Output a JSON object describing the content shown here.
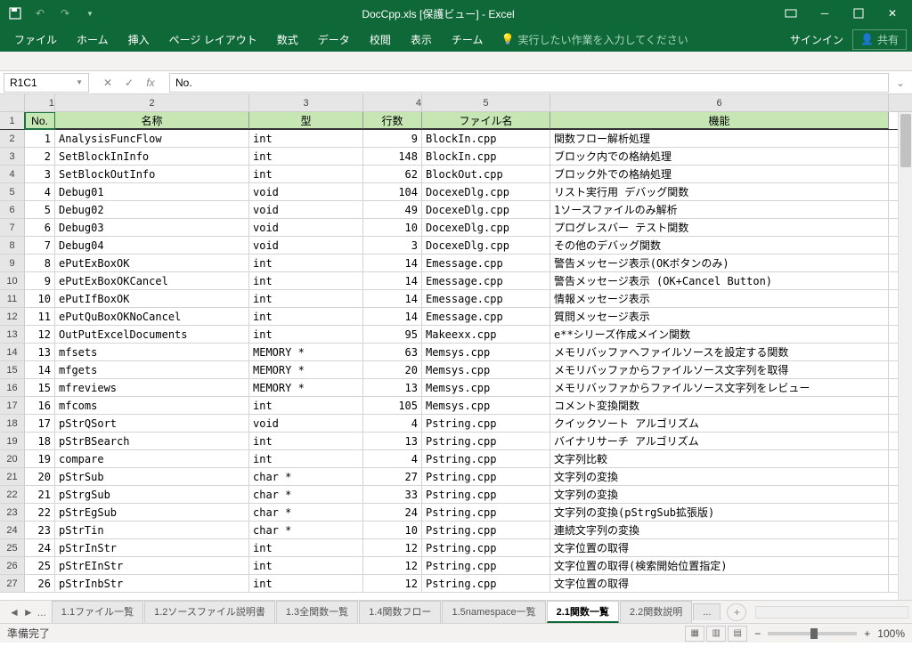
{
  "title": "DocCpp.xls [保護ビュー] - Excel",
  "qat": {
    "save": "",
    "undo": "",
    "redo": ""
  },
  "ribbon": {
    "tabs": [
      "ファイル",
      "ホーム",
      "挿入",
      "ページ レイアウト",
      "数式",
      "データ",
      "校閲",
      "表示",
      "チーム"
    ],
    "tellme": "実行したい作業を入力してください",
    "signin": "サインイン",
    "share": "共有"
  },
  "formula": {
    "namebox": "R1C1",
    "value": "No."
  },
  "cols": [
    "1",
    "2",
    "3",
    "4",
    "5",
    "6"
  ],
  "headers": {
    "no": "No.",
    "name": "名称",
    "type": "型",
    "lines": "行数",
    "file": "ファイル名",
    "func": "機能"
  },
  "rows": [
    {
      "n": 1,
      "name": "AnalysisFuncFlow",
      "t": "int",
      "l": 9,
      "f": "BlockIn.cpp",
      "d": "関数フロー解析処理"
    },
    {
      "n": 2,
      "name": "SetBlockInInfo",
      "t": "int",
      "l": 148,
      "f": "BlockIn.cpp",
      "d": "ブロック内での格納処理"
    },
    {
      "n": 3,
      "name": "SetBlockOutInfo",
      "t": "int",
      "l": 62,
      "f": "BlockOut.cpp",
      "d": "ブロック外での格納処理"
    },
    {
      "n": 4,
      "name": "Debug01",
      "t": "void",
      "l": 104,
      "f": "DocexeDlg.cpp",
      "d": "リスト実行用 デバッグ関数"
    },
    {
      "n": 5,
      "name": "Debug02",
      "t": "void",
      "l": 49,
      "f": "DocexeDlg.cpp",
      "d": "1ソースファイルのみ解析"
    },
    {
      "n": 6,
      "name": "Debug03",
      "t": "void",
      "l": 10,
      "f": "DocexeDlg.cpp",
      "d": "プログレスバー テスト関数"
    },
    {
      "n": 7,
      "name": "Debug04",
      "t": "void",
      "l": 3,
      "f": "DocexeDlg.cpp",
      "d": "その他のデバッグ関数"
    },
    {
      "n": 8,
      "name": "ePutExBoxOK",
      "t": "int",
      "l": 14,
      "f": "Emessage.cpp",
      "d": "警告メッセージ表示(OKボタンのみ)"
    },
    {
      "n": 9,
      "name": "ePutExBoxOKCancel",
      "t": "int",
      "l": 14,
      "f": "Emessage.cpp",
      "d": "警告メッセージ表示 (OK+Cancel Button)"
    },
    {
      "n": 10,
      "name": "ePutIfBoxOK",
      "t": "int",
      "l": 14,
      "f": "Emessage.cpp",
      "d": "情報メッセージ表示"
    },
    {
      "n": 11,
      "name": "ePutQuBoxOKNoCancel",
      "t": "int",
      "l": 14,
      "f": "Emessage.cpp",
      "d": "質問メッセージ表示"
    },
    {
      "n": 12,
      "name": "OutPutExcelDocuments",
      "t": "int",
      "l": 95,
      "f": "Makeexx.cpp",
      "d": "e**シリーズ作成メイン関数"
    },
    {
      "n": 13,
      "name": "mfsets",
      "t": "MEMORY *",
      "l": 63,
      "f": "Memsys.cpp",
      "d": "メモリバッファへファイルソースを設定する関数"
    },
    {
      "n": 14,
      "name": "mfgets",
      "t": "MEMORY *",
      "l": 20,
      "f": "Memsys.cpp",
      "d": "メモリバッファからファイルソース文字列を取得"
    },
    {
      "n": 15,
      "name": "mfreviews",
      "t": "MEMORY *",
      "l": 13,
      "f": "Memsys.cpp",
      "d": "メモリバッファからファイルソース文字列をレビュー"
    },
    {
      "n": 16,
      "name": "mfcoms",
      "t": "int",
      "l": 105,
      "f": "Memsys.cpp",
      "d": "コメント変換関数"
    },
    {
      "n": 17,
      "name": "pStrQSort",
      "t": "void",
      "l": 4,
      "f": "Pstring.cpp",
      "d": "クイックソート アルゴリズム"
    },
    {
      "n": 18,
      "name": "pStrBSearch",
      "t": "int",
      "l": 13,
      "f": "Pstring.cpp",
      "d": "バイナリサーチ アルゴリズム"
    },
    {
      "n": 19,
      "name": "compare",
      "t": "int",
      "l": 4,
      "f": "Pstring.cpp",
      "d": "文字列比較"
    },
    {
      "n": 20,
      "name": "pStrSub",
      "t": "char *",
      "l": 27,
      "f": "Pstring.cpp",
      "d": "文字列の変換"
    },
    {
      "n": 21,
      "name": "pStrgSub",
      "t": "char *",
      "l": 33,
      "f": "Pstring.cpp",
      "d": "文字列の変換"
    },
    {
      "n": 22,
      "name": "pStrEgSub",
      "t": "char *",
      "l": 24,
      "f": "Pstring.cpp",
      "d": "文字列の変換(pStrgSub拡張版)"
    },
    {
      "n": 23,
      "name": "pStrTin",
      "t": "char *",
      "l": 10,
      "f": "Pstring.cpp",
      "d": "連続文字列の変換"
    },
    {
      "n": 24,
      "name": "pStrInStr",
      "t": "int",
      "l": 12,
      "f": "Pstring.cpp",
      "d": "文字位置の取得"
    },
    {
      "n": 25,
      "name": "pStrEInStr",
      "t": "int",
      "l": 12,
      "f": "Pstring.cpp",
      "d": "文字位置の取得(検索開始位置指定)"
    },
    {
      "n": 26,
      "name": "pStrInbStr",
      "t": "int",
      "l": 12,
      "f": "Pstring.cpp",
      "d": "文字位置の取得"
    }
  ],
  "sheets": {
    "ellipsis": "...",
    "tabs": [
      "1.1ファイル一覧",
      "1.2ソースファイル説明書",
      "1.3全関数一覧",
      "1.4関数フロー",
      "1.5namespace一覧",
      "2.1関数一覧",
      "2.2関数説明"
    ],
    "active": 5,
    "more": "..."
  },
  "status": {
    "ready": "準備完了",
    "zoom": "100%"
  }
}
